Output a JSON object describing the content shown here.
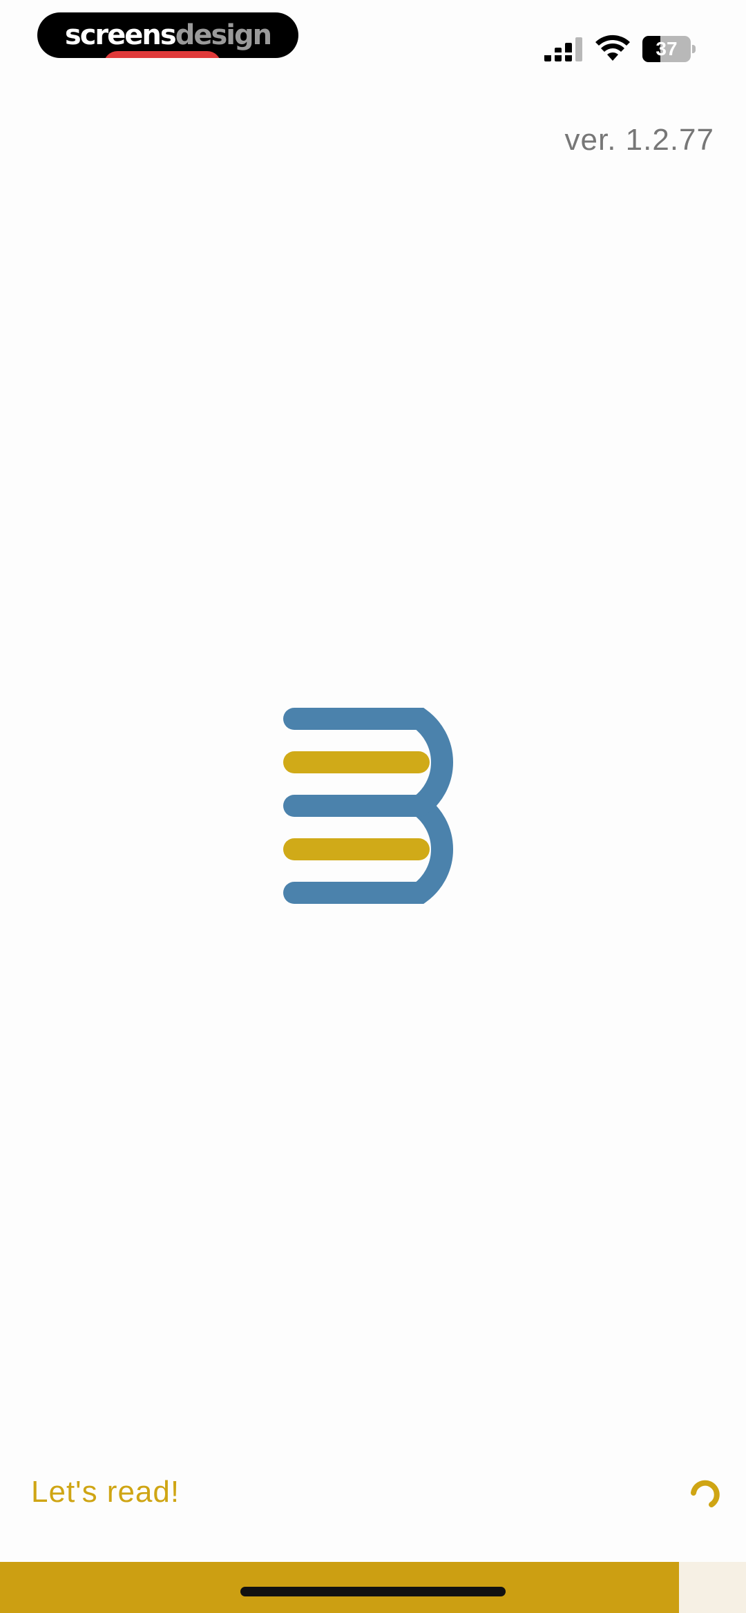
{
  "status_bar": {
    "brand_part1": "screens",
    "brand_part2": "design",
    "battery_level": "37",
    "battery_fraction": 0.37
  },
  "version_label": "ver. 1.2.77",
  "logo": {
    "icon": "book-b-logo-icon",
    "colors": {
      "blue": "#4b82ac",
      "gold": "#d0aa18"
    }
  },
  "footer": {
    "loading_text": "Let's read!",
    "spinner_icon": "loading-spinner-icon",
    "accent_color": "#cc9f12",
    "progress_fraction": 0.91
  }
}
